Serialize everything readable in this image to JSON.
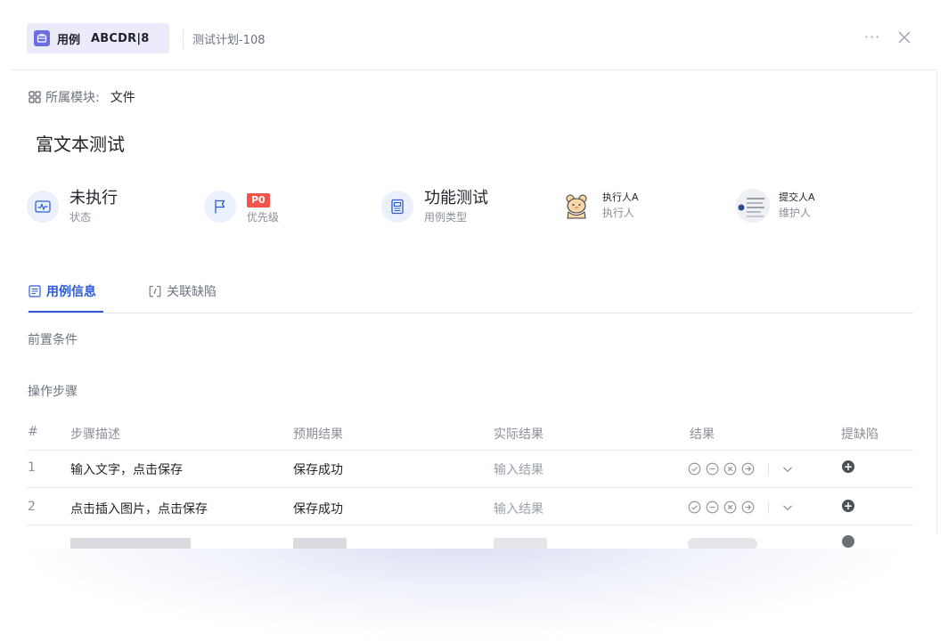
{
  "header": {
    "case_label": "用例",
    "case_code": "ABCDR|8",
    "plan_link": "测试计划-108",
    "more_label": "···",
    "close_icon": "close-icon"
  },
  "module": {
    "icon": "grid-icon",
    "label": "所属模块:",
    "value": "文件"
  },
  "case_title": "富文本测试",
  "meta": {
    "status": {
      "value": "未执行",
      "label": "状态",
      "icon": "pulse-icon"
    },
    "priority": {
      "value": "P0",
      "label": "优先级",
      "icon": "flag-icon",
      "color": "#f2554b"
    },
    "type": {
      "value": "功能测试",
      "label": "用例类型",
      "icon": "document-icon"
    },
    "executor": {
      "value": "执行人A",
      "label": "执行人",
      "icon": "bear-avatar"
    },
    "maintainer": {
      "value": "提交人A",
      "label": "维护人",
      "icon": "user-avatar"
    }
  },
  "tabs": [
    {
      "label": "用例信息",
      "icon": "info-doc-icon",
      "active": true
    },
    {
      "label": "关联缺陷",
      "icon": "link-icon",
      "active": false
    }
  ],
  "sections": {
    "precondition_label": "前置条件",
    "steps_label": "操作步骤"
  },
  "steps_table": {
    "columns": [
      "#",
      "步骤描述",
      "预期结果",
      "实际结果",
      "结果",
      "提缺陷"
    ],
    "rows": [
      {
        "num": "1",
        "description": "输入文字，点击保存",
        "expected": "保存成功",
        "actual_placeholder": "输入结果"
      },
      {
        "num": "2",
        "description": "点击插入图片，点击保存",
        "expected": "保存成功",
        "actual_placeholder": "输入结果"
      }
    ],
    "result_icons": [
      "pass-icon",
      "block-icon",
      "fail-icon",
      "skip-icon"
    ],
    "accent": "#2d5bd7"
  }
}
